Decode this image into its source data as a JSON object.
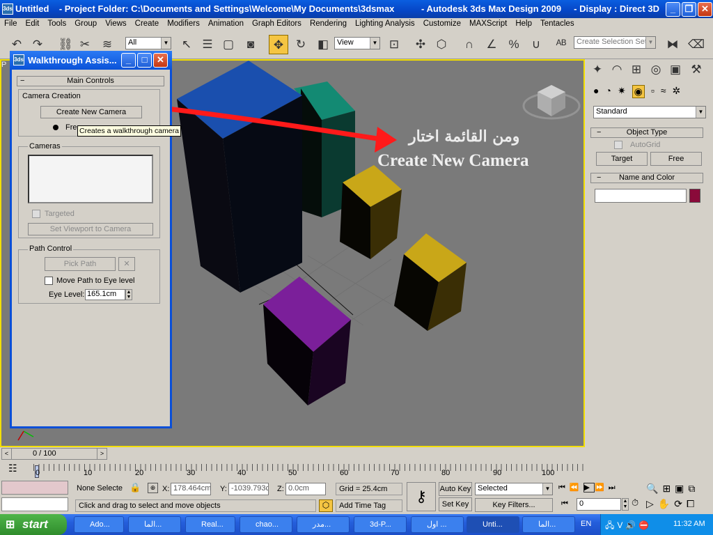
{
  "app": {
    "title_left": "Untitled    - Project Folder: C:\\Documents and Settings\\Welcome\\My Documents\\3dsmax",
    "title_right": "- Autodesk 3ds Max Design 2009     - Display : Direct 3D",
    "icon": "3ds"
  },
  "menu": [
    "File",
    "Edit",
    "Tools",
    "Group",
    "Views",
    "Create",
    "Modifiers",
    "Animation",
    "Graph Editors",
    "Rendering",
    "Lighting Analysis",
    "Customize",
    "MAXScript",
    "Help",
    "Tentacles"
  ],
  "toolbar": {
    "filter": "All",
    "refcoord": "View",
    "selection_set_placeholder": "Create Selection Set"
  },
  "viewport": {
    "overlay_arabic": "ومن القائمة اختار",
    "overlay_english": "Create New Camera",
    "label": "P"
  },
  "walkthrough": {
    "title": "Walkthrough Assis...",
    "rollout": "Main Controls",
    "camera_creation": "Camera Creation",
    "create_btn": "Create New Camera",
    "free_label": "Free",
    "tooltip": "Creates a walkthrough camera",
    "cameras": "Cameras",
    "targeted": "Targeted",
    "set_viewport": "Set Viewport to Camera",
    "path_control": "Path Control",
    "pick_path": "Pick Path",
    "move_path": "Move Path to Eye level",
    "eye_level_label": "Eye Level:",
    "eye_level_value": "165.1cm"
  },
  "rightpanel": {
    "category": "Standard",
    "object_type": "Object Type",
    "autogrid": "AutoGrid",
    "target": "Target",
    "free": "Free",
    "name_color": "Name and Color",
    "swatch": "#8a0a3a"
  },
  "time": {
    "slider": "0 / 100",
    "ticks": [
      "0",
      "10",
      "20",
      "30",
      "40",
      "50",
      "60",
      "70",
      "80",
      "90",
      "100"
    ]
  },
  "status": {
    "selection": "None Selecte",
    "x_label": "X:",
    "x": "178.464cm",
    "y_label": "Y:",
    "y": "-1039.793c",
    "z_label": "Z:",
    "z": "0.0cm",
    "grid": "Grid = 25.4cm",
    "prompt": "Click and drag to select and move objects",
    "add_time_tag": "Add Time Tag",
    "auto_key": "Auto Key",
    "set_key": "Set Key",
    "selected": "Selected",
    "key_filters": "Key Filters...",
    "frame": "0"
  },
  "taskbar": {
    "start": "start",
    "tasks": [
      "Ado...",
      "الما...",
      "Real...",
      "chao...",
      "مدر...",
      "3d-P...",
      "اول ...",
      "Unti...",
      "الما..."
    ],
    "lang": "EN",
    "clock": "11:32 AM"
  },
  "colors": {
    "accent": "#0a52d8",
    "viewport_border": "#f3df00",
    "annotation": "#ff1a1a"
  }
}
